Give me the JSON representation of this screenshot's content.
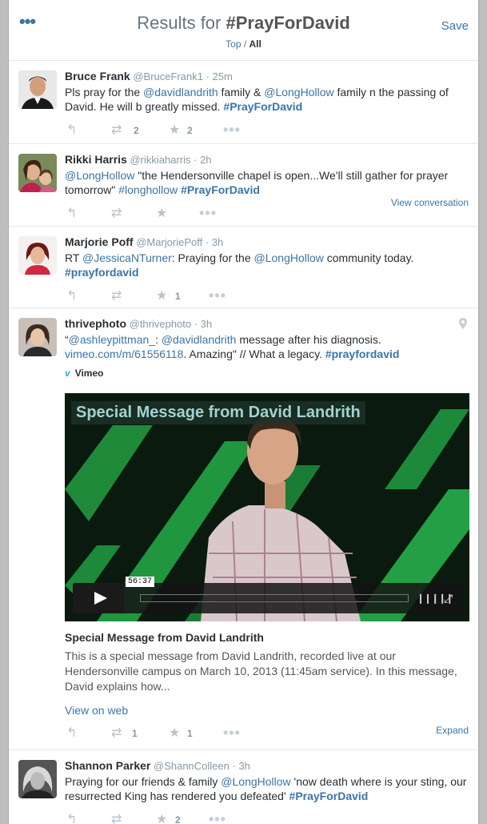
{
  "header": {
    "title_prefix": "Results for ",
    "title_tag": "#PrayForDavid",
    "save_label": "Save",
    "filter_top": "Top",
    "filter_sep": " / ",
    "filter_all": "All"
  },
  "tweets": [
    {
      "name": "Bruce Frank",
      "handle": "@BruceFrank1",
      "time": "25m",
      "t1": "Pls pray for the ",
      "m1": "@davidlandrith",
      "t2": " family & ",
      "m2": "@LongHollow",
      "t3": " family n the passing of David. He will b greatly missed. ",
      "h1": "#PrayForDavid",
      "retweets": "2",
      "favorites": "2"
    },
    {
      "name": "Rikki Harris",
      "handle": "@rikkiaharris",
      "time": "2h",
      "m1": "@LongHollow",
      "t1": " \"the Hendersonville chapel is open...We'll still gather for prayer tomorrow\" ",
      "h1": "#longhollow",
      "h2": "#PrayForDavid",
      "view_conversation": "View conversation"
    },
    {
      "name": "Marjorie Poff",
      "handle": "@MarjoriePoff",
      "time": "3h",
      "t1": "RT ",
      "m1": "@JessicaNTurner",
      "t2": ": Praying for the ",
      "m2": "@LongHollow",
      "t3": " community today.",
      "h1": "#prayfordavid",
      "favorites": "1"
    },
    {
      "name": "thrivephoto",
      "handle": "@thrivephoto",
      "time": "3h",
      "q": "“",
      "m1": "@ashleypittman_",
      "t1": ": ",
      "m2": "@davidlandrith",
      "t2": " message after his diagnosis.",
      "url": "vimeo.com/m/61556118",
      "t3": ".  Amazing\" // What a legacy. ",
      "h1": "#prayfordavid",
      "card_source": "Vimeo",
      "video_title_overlay": "Special Message from David Landrith",
      "video_time": "56:37",
      "card_title": "Special Message from David Landrith",
      "card_description": "This is a special message from David Landrith, recorded live at our Hendersonville campus on March 10, 2013 (11:45am service). In this message, David explains how...",
      "view_on_web": "View on web",
      "expand": "Expand",
      "retweets": "1",
      "favorites": "1"
    },
    {
      "name": "Shannon Parker",
      "handle": "@ShannColleen",
      "time": "3h",
      "t1": "Praying for our friends & family  ",
      "m1": "@LongHollow",
      "t2": " 'now death where is your sting, our resurrected King has rendered you defeated' ",
      "h1": "#PrayForDavid",
      "favorites": "2"
    }
  ],
  "icons": {
    "reply": "↰",
    "retweet": "⇄",
    "favorite": "★",
    "more": "•••",
    "menu": "•••",
    "sep": " · "
  },
  "colors": {
    "link": "#3b74a8",
    "text": "#292f33",
    "muted": "#8899a6"
  }
}
